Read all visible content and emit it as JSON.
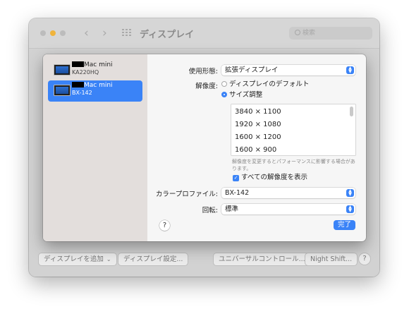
{
  "window": {
    "title": "ディスプレイ",
    "search_placeholder": "検索",
    "back_glyph": "‹",
    "forward_glyph": "›"
  },
  "bottom_bar": {
    "add_display_label": "ディスプレイを追加",
    "add_display_chevron": "⌄",
    "display_settings_label": "ディスプレイ設定...",
    "universal_control_label": "ユニバーサルコントロール...",
    "night_shift_label": "Night Shift...",
    "help_label": "?"
  },
  "sidebar": {
    "displays": [
      {
        "name_suffix": "Mac mini",
        "model": "KA220HQ",
        "selected": false
      },
      {
        "name_suffix": "Mac mini",
        "model": "BX-142",
        "selected": true
      }
    ]
  },
  "settings": {
    "usage_label": "使用形態:",
    "usage_value": "拡張ディスプレイ",
    "resolution_label": "解像度:",
    "resolution_options": [
      {
        "label": "ディスプレイのデフォルト",
        "checked": false
      },
      {
        "label": "サイズ調整",
        "checked": true
      }
    ],
    "resolutions": [
      "3840 × 1100",
      "1920 × 1080",
      "1600 × 1200",
      "1600 × 900"
    ],
    "resolution_note": "解像度を変更するとパフォーマンスに影響する場合があります。",
    "show_all_label": "すべての解像度を表示",
    "show_all_checked": true,
    "color_profile_label": "カラープロファイル:",
    "color_profile_value": "BX-142",
    "rotation_label": "回転:",
    "rotation_value": "標準",
    "help_label": "?",
    "done_label": "完了"
  },
  "colors": {
    "accent": "#3a83f7"
  },
  "icons": {
    "popup_arrow": "up-down-chevron-icon",
    "checkmark": "✓"
  }
}
